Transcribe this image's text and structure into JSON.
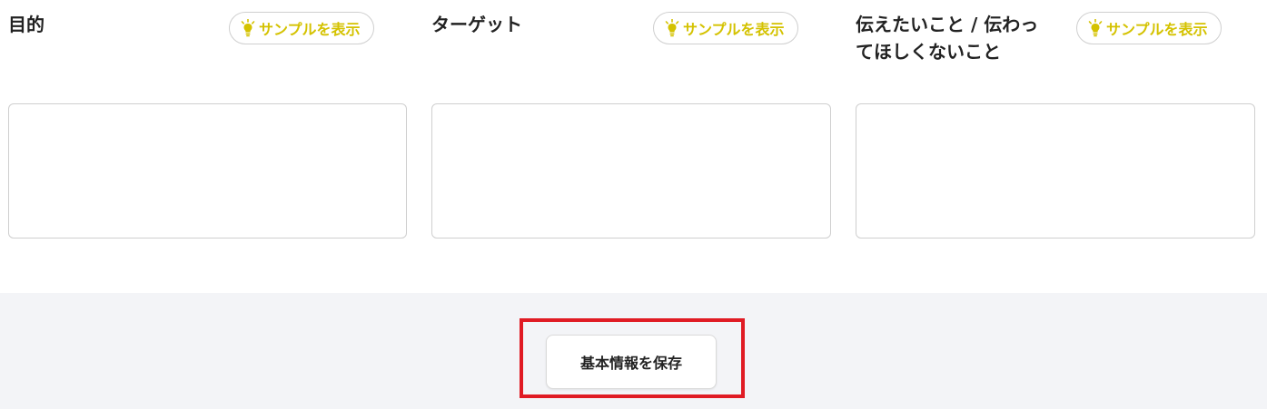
{
  "fields": [
    {
      "label": "目的",
      "sample_button_label": "サンプルを表示",
      "value": ""
    },
    {
      "label": "ターゲット",
      "sample_button_label": "サンプルを表示",
      "value": ""
    },
    {
      "label": "伝えたいこと / 伝わっ\nてほしくないこと",
      "sample_button_label": "サンプルを表示",
      "value": ""
    }
  ],
  "footer": {
    "save_button_label": "基本情報を保存"
  },
  "colors": {
    "sample_accent": "#d4c200",
    "highlight": "#e01b24",
    "footer_bg": "#f3f4f7"
  },
  "icons": {
    "sample_button": "lightbulb-icon"
  }
}
